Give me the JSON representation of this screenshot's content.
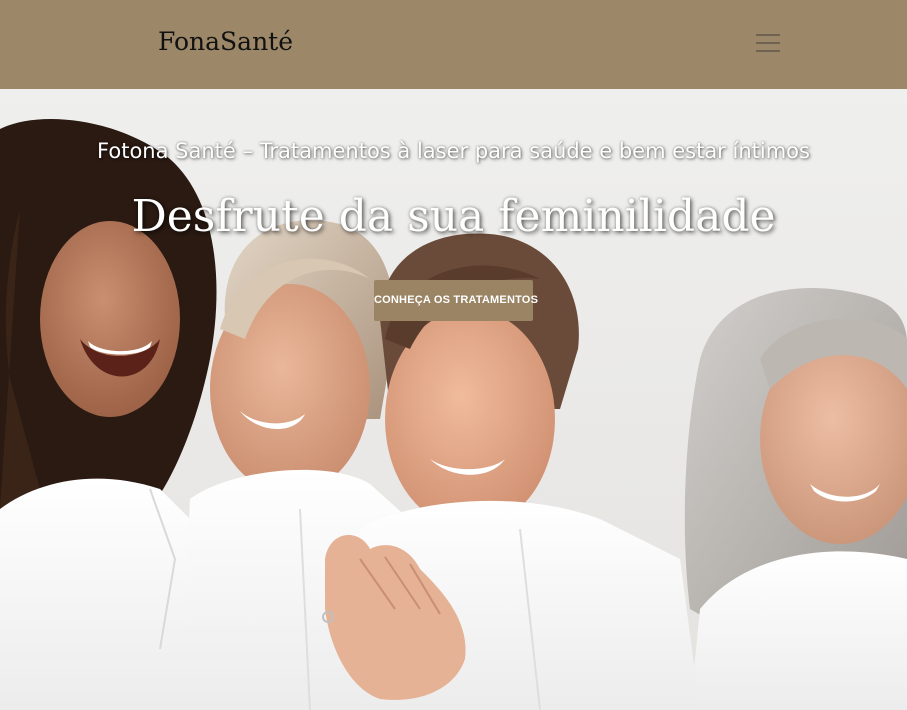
{
  "header": {
    "logo_text": "FonaSanté",
    "menu_icon": "hamburger-menu-icon"
  },
  "hero": {
    "tagline": "Fotona Santé – Tratamentos à laser para saúde e bem estar íntimos",
    "headline": "Desfrute da sua feminilidade",
    "cta_label": "CONHEÇA OS TRATAMENTOS",
    "image_subject": "four smiling women in white shirts"
  },
  "colors": {
    "header_bg": "#9c8868",
    "cta_bg": "#9a8464",
    "hero_bg": "#efefed",
    "text_light": "#ffffff",
    "logo_text": "#111111"
  }
}
